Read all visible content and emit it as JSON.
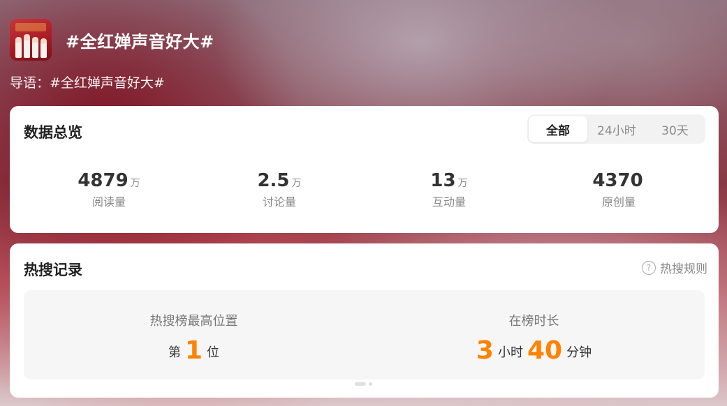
{
  "topic": {
    "title": "#全红婵声音好大#",
    "lead_label": "导语：",
    "lead_text": "#全红婵声音好大#"
  },
  "overview": {
    "title": "数据总览",
    "tabs": [
      {
        "label": "全部",
        "active": true
      },
      {
        "label": "24小时",
        "active": false
      },
      {
        "label": "30天",
        "active": false
      }
    ],
    "stats": [
      {
        "value": "4879",
        "unit": "万",
        "label": "阅读量"
      },
      {
        "value": "2.5",
        "unit": "万",
        "label": "讨论量"
      },
      {
        "value": "13",
        "unit": "万",
        "label": "互动量"
      },
      {
        "value": "4370",
        "unit": "",
        "label": "原创量"
      }
    ]
  },
  "hot_search": {
    "title": "热搜记录",
    "rules_label": "热搜规则",
    "peak": {
      "heading": "热搜榜最高位置",
      "prefix": "第",
      "value": "1",
      "suffix": "位"
    },
    "duration": {
      "heading": "在榜时长",
      "hours": "3",
      "hours_unit": "小时",
      "minutes": "40",
      "minutes_unit": "分钟"
    }
  },
  "colors": {
    "accent": "#ff8200",
    "card_bg": "#ffffff",
    "inner_bg": "#f6f6f6"
  }
}
